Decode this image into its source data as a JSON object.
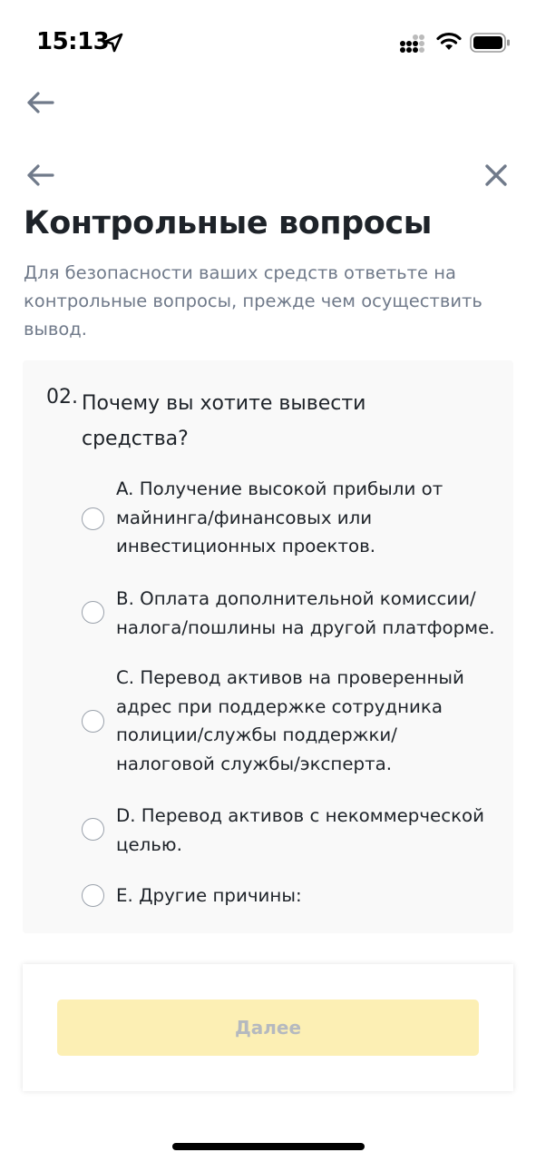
{
  "status_bar": {
    "time": "15:13",
    "icons": [
      "location-arrow-icon",
      "cellular-signal-icon",
      "wifi-icon",
      "battery-icon"
    ]
  },
  "nav": {
    "back_icon": "arrow-left-icon",
    "close_icon": "close-icon"
  },
  "page": {
    "title": "Контрольные вопросы",
    "description": "Для безопасности ваших средств ответьте на контрольные вопросы, прежде чем осуществить вывод."
  },
  "question": {
    "number": "02.",
    "text": "Почему вы хотите вывести средства?",
    "options": [
      {
        "label": "A. Получение высокой прибыли от майнинга/финансовых или инвестиционных проектов.",
        "selected": false
      },
      {
        "label": "B. Оплата дополнительной комиссии/ налога/пошлины на другой платформе.",
        "selected": false
      },
      {
        "label": "C. Перевод активов на проверенный адрес при поддержке сотрудника полиции/службы поддержки/ налоговой службы/эксперта.",
        "selected": false
      },
      {
        "label": "D. Перевод активов с некоммерческой целью.",
        "selected": false
      },
      {
        "label": "E. Другие причины:",
        "selected": false
      }
    ]
  },
  "footer": {
    "next_label": "Далее",
    "next_enabled": false
  },
  "colors": {
    "primary_text": "#1e2329",
    "secondary_text": "#707a8a",
    "button_disabled_bg": "#fcefb4",
    "button_disabled_text": "#b5b9bf",
    "card_bg": "#f9f9f9"
  }
}
